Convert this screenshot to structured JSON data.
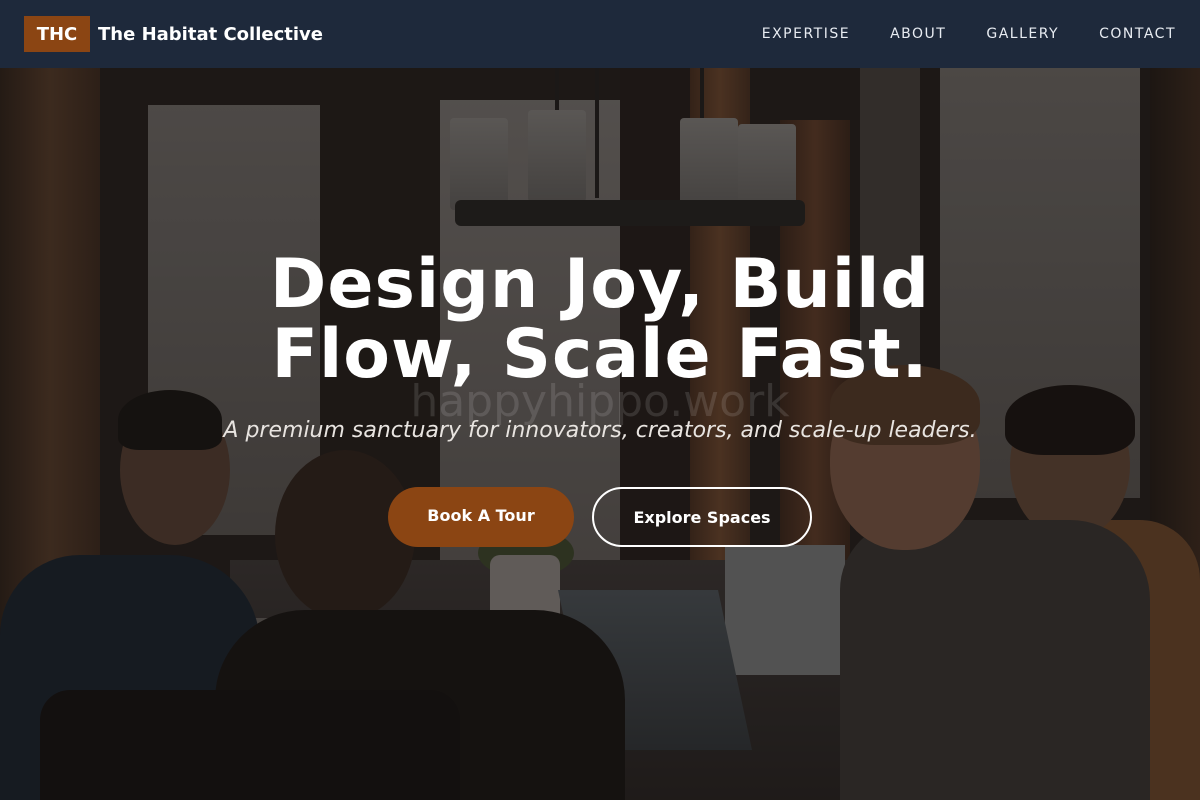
{
  "brand": {
    "logo_text": "THC",
    "name": "The Habitat Collective",
    "accent_color": "#8b4513"
  },
  "nav": {
    "items": [
      {
        "label": "EXPERTISE"
      },
      {
        "label": "ABOUT"
      },
      {
        "label": "GALLERY"
      },
      {
        "label": "CONTACT"
      }
    ],
    "background_color": "#1e293b"
  },
  "hero": {
    "headline": "Design Joy, Build Flow, Scale Fast.",
    "watermark": "happyhippo.work",
    "subtitle": "A premium sanctuary for innovators, creators, and scale-up leaders.",
    "primary_cta": "Book A Tour",
    "secondary_cta": "Explore Spaces",
    "background_image": "photo of people working on laptops around a shared table in a café-style coworking space"
  }
}
